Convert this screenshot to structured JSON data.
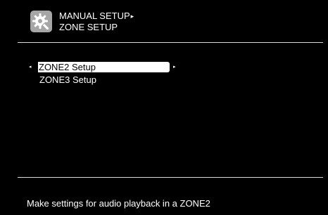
{
  "header": {
    "icon": "settings-gear-wrench-icon",
    "breadcrumb_parent": "MANUAL SETUP",
    "breadcrumb_arrow": "▸",
    "title": "ZONE SETUP"
  },
  "menu": {
    "arrow_left": "◂",
    "arrow_right": "▸",
    "items": [
      {
        "label": "ZONE2 Setup",
        "selected": true
      },
      {
        "label": "ZONE3 Setup",
        "selected": false
      }
    ]
  },
  "status_text": "Make settings for audio playback in a ZONE2",
  "colors": {
    "background": "#000000",
    "text": "#ffffff",
    "selection": "#ffffff",
    "icon_bg": "#a6a6a6"
  }
}
